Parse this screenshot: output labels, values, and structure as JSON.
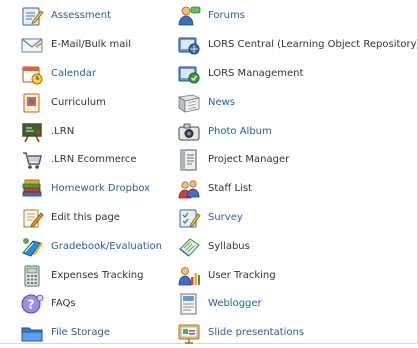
{
  "colors": {
    "link": "#2060a8",
    "text": "#333333"
  },
  "left": [
    {
      "label": "Assessment",
      "icon": "assessment-icon",
      "link": true
    },
    {
      "label": "E-Mail/Bulk mail",
      "icon": "envelope-icon",
      "link": false
    },
    {
      "label": "Calendar",
      "icon": "calendar-icon",
      "link": true
    },
    {
      "label": "Curriculum",
      "icon": "curriculum-icon",
      "link": false
    },
    {
      "label": ".LRN",
      "icon": "chalkboard-icon",
      "link": false
    },
    {
      "label": ".LRN Ecommerce",
      "icon": "shopping-cart-icon",
      "link": false
    },
    {
      "label": "Homework Dropbox",
      "icon": "books-icon",
      "link": true
    },
    {
      "label": "Edit this page",
      "icon": "edit-page-icon",
      "link": false
    },
    {
      "label": "Gradebook/Evaluation",
      "icon": "gradebook-icon",
      "link": true
    },
    {
      "label": "Expenses Tracking",
      "icon": "calculator-icon",
      "link": false
    },
    {
      "label": "FAQs",
      "icon": "faq-icon",
      "link": false
    },
    {
      "label": "File Storage",
      "icon": "folder-icon",
      "link": true
    }
  ],
  "right": [
    {
      "label": "Forums",
      "icon": "forums-icon",
      "link": true
    },
    {
      "label": "LORS Central (Learning Object Repository)",
      "icon": "lors-central-icon",
      "link": false
    },
    {
      "label": "LORS Management",
      "icon": "lors-management-icon",
      "link": false
    },
    {
      "label": "News",
      "icon": "newspaper-icon",
      "link": true
    },
    {
      "label": "Photo Album",
      "icon": "camera-icon",
      "link": true
    },
    {
      "label": "Project Manager",
      "icon": "project-manager-icon",
      "link": false
    },
    {
      "label": "Staff List",
      "icon": "staff-list-icon",
      "link": false
    },
    {
      "label": "Survey",
      "icon": "survey-icon",
      "link": true
    },
    {
      "label": "Syllabus",
      "icon": "syllabus-icon",
      "link": false
    },
    {
      "label": "User Tracking",
      "icon": "user-tracking-icon",
      "link": false
    },
    {
      "label": "Weblogger",
      "icon": "weblogger-icon",
      "link": true
    },
    {
      "label": "Slide presentations",
      "icon": "slides-icon",
      "link": true
    }
  ]
}
